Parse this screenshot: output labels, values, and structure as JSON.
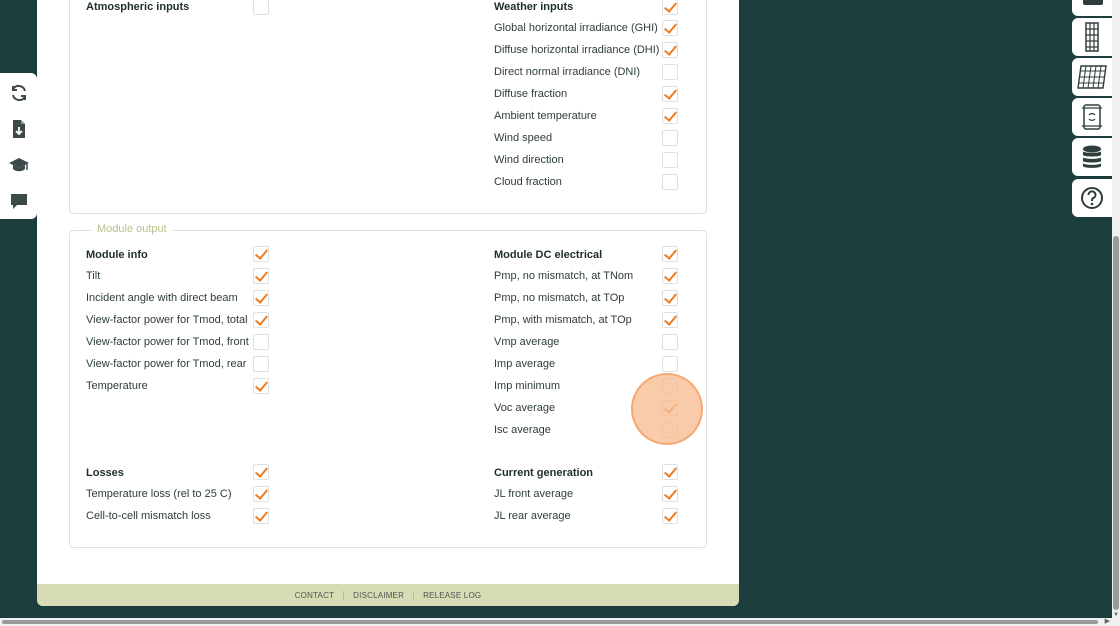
{
  "atmospheric": {
    "title": "Atmospheric inputs",
    "checked": false
  },
  "weather": {
    "title": "Weather inputs",
    "checked": true,
    "items": [
      {
        "label": "Global horizontal irradiance (GHI)",
        "checked": true
      },
      {
        "label": "Diffuse horizontal irradiance (DHI)",
        "checked": true
      },
      {
        "label": "Direct normal irradiance (DNI)",
        "checked": false
      },
      {
        "label": "Diffuse fraction",
        "checked": true
      },
      {
        "label": "Ambient temperature",
        "checked": true
      },
      {
        "label": "Wind speed",
        "checked": false
      },
      {
        "label": "Wind direction",
        "checked": false
      },
      {
        "label": "Cloud fraction",
        "checked": false
      }
    ]
  },
  "module_output": {
    "legend": "Module output",
    "module_info": {
      "title": "Module info",
      "checked": true,
      "items": [
        {
          "label": "Tilt",
          "checked": true
        },
        {
          "label": "Incident angle with direct beam",
          "checked": true
        },
        {
          "label": "View-factor power for Tmod, total",
          "checked": true
        },
        {
          "label": "View-factor power for Tmod, front",
          "checked": false
        },
        {
          "label": "View-factor power for Tmod, rear",
          "checked": false
        },
        {
          "label": "Temperature",
          "checked": true
        }
      ]
    },
    "module_dc": {
      "title": "Module DC electrical",
      "checked": true,
      "items": [
        {
          "label": "Pmp, no mismatch, at TNom",
          "checked": true
        },
        {
          "label": "Pmp, no mismatch, at TOp",
          "checked": true
        },
        {
          "label": "Pmp, with mismatch, at TOp",
          "checked": true
        },
        {
          "label": "Vmp average",
          "checked": false
        },
        {
          "label": "Imp average",
          "checked": false
        },
        {
          "label": "Imp minimum",
          "checked": false
        },
        {
          "label": "Voc average",
          "checked": true
        },
        {
          "label": "Isc average",
          "checked": false
        }
      ]
    },
    "losses": {
      "title": "Losses",
      "checked": true,
      "items": [
        {
          "label": "Temperature loss (rel to 25 C)",
          "checked": true
        },
        {
          "label": "Cell-to-cell mismatch loss",
          "checked": true
        }
      ]
    },
    "current_generation": {
      "title": "Current generation",
      "checked": true,
      "items": [
        {
          "label": "JL front average",
          "checked": true
        },
        {
          "label": "JL rear average",
          "checked": true
        }
      ]
    }
  },
  "footer": {
    "links": [
      "CONTACT",
      "DISCLAIMER",
      "RELEASE LOG"
    ]
  },
  "left_toolbar": {
    "icons": [
      "refresh-icon",
      "download-file-icon",
      "graduation-cap-icon",
      "chat-icon"
    ]
  },
  "right_toolbar": {
    "icons": [
      "layers-icon",
      "single-panel-icon",
      "panel-grid-icon",
      "inverter-icon",
      "database-icon",
      "help-icon"
    ]
  },
  "colors": {
    "background": "#1b3d3c",
    "accent": "#ef7d22",
    "footer": "#d8dcb4",
    "legend": "#b9c08b"
  }
}
